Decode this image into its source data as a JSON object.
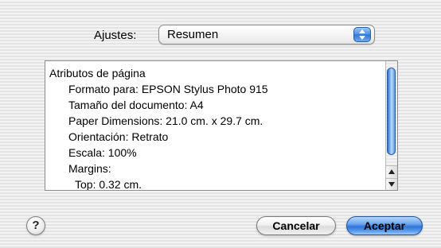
{
  "settings": {
    "label": "Ajustes:",
    "selected": "Resumen"
  },
  "summary": {
    "lines": [
      "Atributos de página",
      "Formato para:  EPSON Stylus Photo 915",
      "Tamaño del documento:  A4",
      "Paper Dimensions:  21.0 cm. x 29.7 cm.",
      "Orientación:  Retrato",
      "Escala:  100%",
      "Margins:",
      "Top:  0.32 cm."
    ]
  },
  "footer": {
    "help": "?",
    "cancel_label": "Cancelar",
    "accept_label": "Aceptar"
  },
  "colors": {
    "accent": "#3a7fe0",
    "window_bg": "#ececec"
  },
  "icons": {
    "popup": "up-down-arrows-icon",
    "scroll_up": "scroll-up-arrow-icon",
    "scroll_down": "scroll-down-arrow-icon",
    "help": "help-icon"
  }
}
